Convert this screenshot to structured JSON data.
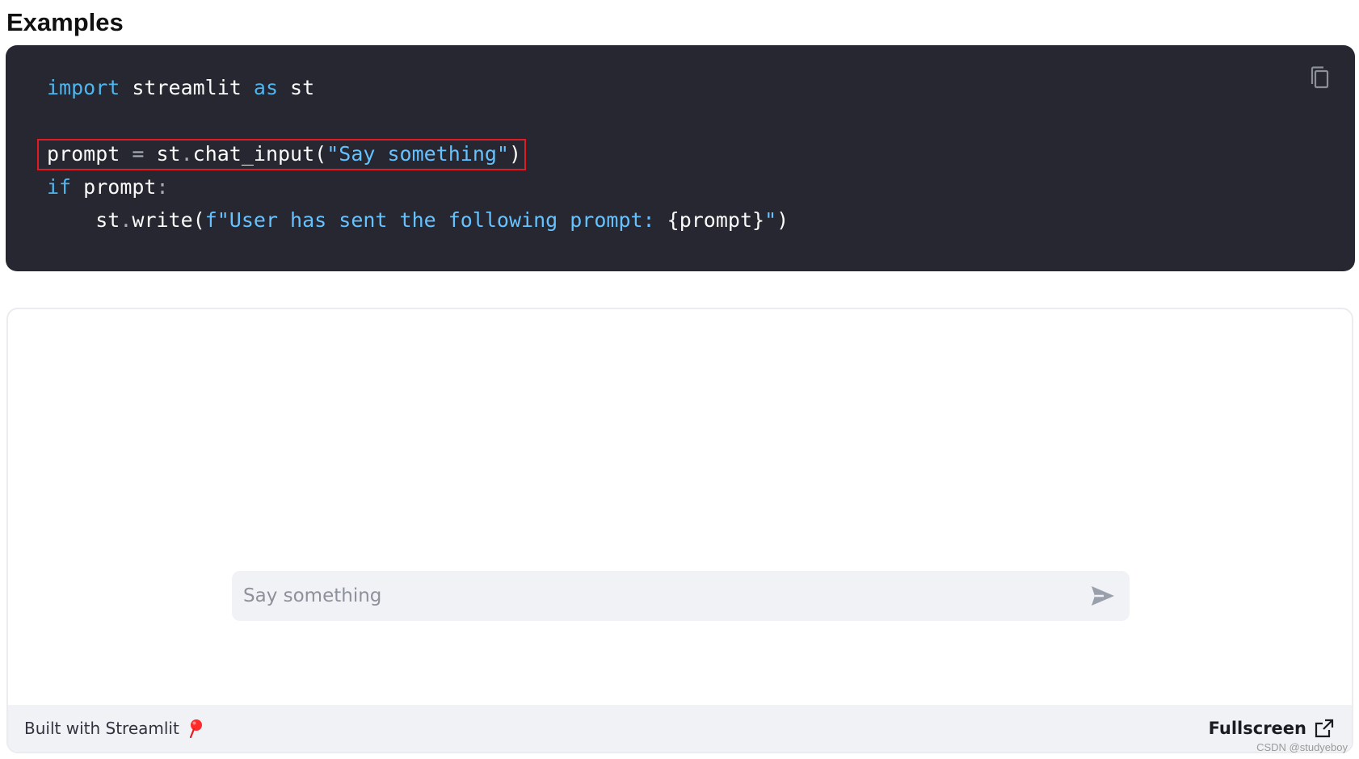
{
  "heading": "Examples",
  "code": {
    "lines": [
      {
        "kw1": "import",
        "t1": " streamlit ",
        "kw2": "as",
        "t2": " st"
      },
      {},
      {
        "a": "prompt ",
        "op": "=",
        "b": " st",
        "dot": ".",
        "c": "chat_input(",
        "str": "\"Say something\"",
        "d": ")"
      },
      {
        "kw": "if",
        "a": " prompt",
        "op": ":"
      },
      {
        "indent": "    ",
        "a": "st",
        "dot": ".",
        "b": "write(",
        "str": "f\"User has sent the following prompt: ",
        "c": "{prompt}",
        "str2": "\"",
        "d": ")"
      }
    ]
  },
  "icons": {
    "copy": "copy-icon",
    "send": "send-icon",
    "pin": "pin-icon",
    "external": "external-link-icon"
  },
  "chat": {
    "placeholder": "Say something"
  },
  "footer": {
    "built": "Built with Streamlit",
    "fullscreen": "Fullscreen"
  },
  "watermark": "CSDN @studyeboy",
  "colors": {
    "code_bg": "#262730",
    "keyword": "#4db6f0",
    "highlight_box": "#e01b24",
    "input_bg": "#f0f2f6"
  }
}
